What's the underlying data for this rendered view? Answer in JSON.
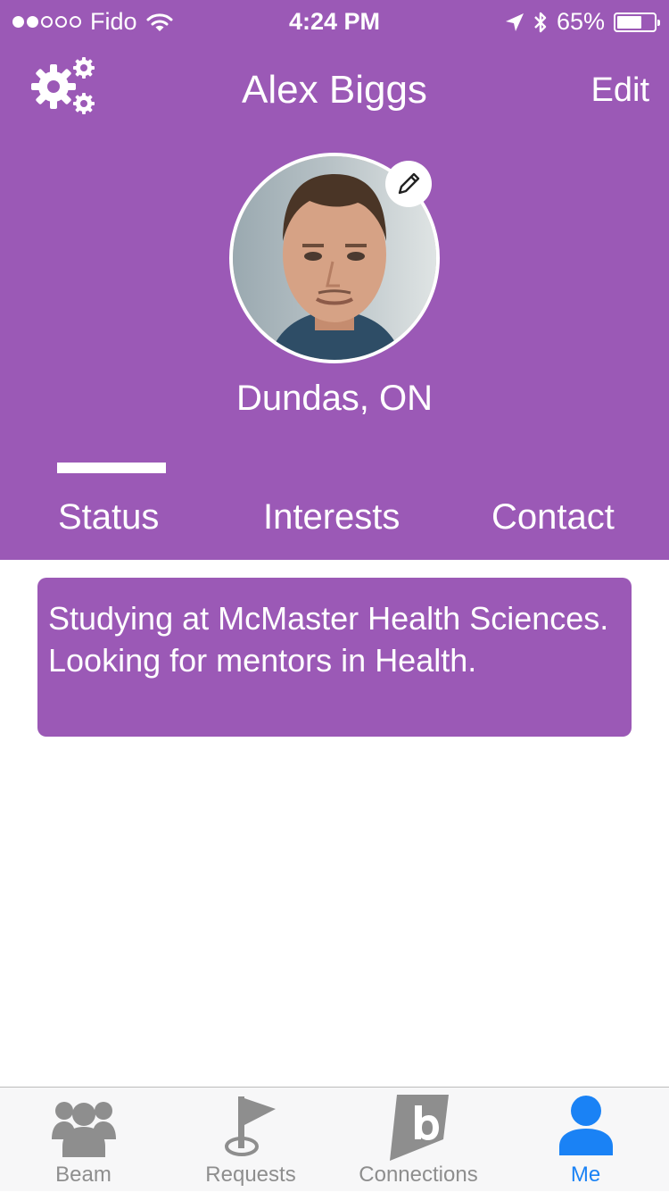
{
  "status_bar": {
    "carrier": "Fido",
    "time": "4:24 PM",
    "battery": "65%",
    "battery_level": 0.65,
    "signal_bars": 2,
    "signal_total": 5
  },
  "header": {
    "title": "Alex Biggs",
    "edit_label": "Edit",
    "location": "Dundas, ON"
  },
  "tabs": [
    {
      "label": "Status",
      "active": true
    },
    {
      "label": "Interests",
      "active": false
    },
    {
      "label": "Contact",
      "active": false
    }
  ],
  "status": {
    "text": "Studying at McMaster Health Sciences. Looking for mentors in Health."
  },
  "tab_bar": {
    "items": [
      {
        "label": "Beam",
        "icon": "group-icon",
        "active": false
      },
      {
        "label": "Requests",
        "icon": "flag-icon",
        "active": false
      },
      {
        "label": "Connections",
        "icon": "b-logo-icon",
        "active": false
      },
      {
        "label": "Me",
        "icon": "person-icon",
        "active": true
      }
    ]
  },
  "colors": {
    "accent": "#9b59b6",
    "tab_active": "#1a82f5",
    "tab_inactive": "#8e8e8e"
  }
}
